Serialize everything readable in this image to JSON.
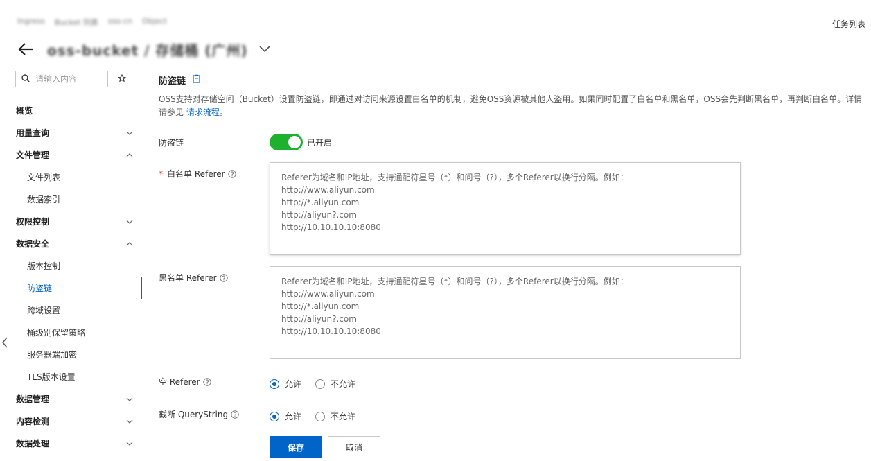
{
  "header": {
    "breadcrumb": [
      "Ingress",
      "Bucket 列表",
      "oss-cn",
      "Object"
    ],
    "task_list": "任务列表",
    "bucket_title": "oss-bucket / 存储桶 (广州)"
  },
  "sidebar": {
    "search_placeholder": "请输入内容",
    "items": [
      {
        "label": "概览",
        "type": "group",
        "chevron": "none"
      },
      {
        "label": "用量查询",
        "type": "group",
        "chevron": "down"
      },
      {
        "label": "文件管理",
        "type": "group",
        "chevron": "up"
      },
      {
        "label": "文件列表",
        "type": "sub",
        "chevron": "none"
      },
      {
        "label": "数据索引",
        "type": "sub",
        "chevron": "none"
      },
      {
        "label": "权限控制",
        "type": "group",
        "chevron": "down"
      },
      {
        "label": "数据安全",
        "type": "group",
        "chevron": "up"
      },
      {
        "label": "版本控制",
        "type": "sub",
        "chevron": "none"
      },
      {
        "label": "防盗链",
        "type": "sub",
        "chevron": "none",
        "active": true
      },
      {
        "label": "跨域设置",
        "type": "sub",
        "chevron": "none"
      },
      {
        "label": "桶级别保留策略",
        "type": "sub",
        "chevron": "none"
      },
      {
        "label": "服务器端加密",
        "type": "sub",
        "chevron": "none"
      },
      {
        "label": "TLS版本设置",
        "type": "sub",
        "chevron": "none"
      },
      {
        "label": "数据管理",
        "type": "group",
        "chevron": "down"
      },
      {
        "label": "内容检测",
        "type": "group",
        "chevron": "down"
      },
      {
        "label": "数据处理",
        "type": "group",
        "chevron": "down"
      }
    ]
  },
  "main": {
    "title": "防盗链",
    "desc_text": "OSS支持对存储空间（Bucket）设置防盗链，即通过对访问来源设置白名单的机制，避免OSS资源被其他人盗用。如果同时配置了白名单和黑名单，OSS会先判断黑名单，再判断白名单。详情请参见 ",
    "desc_link": "请求流程",
    "desc_end": "。",
    "hotlink_label": "防盗链",
    "switch_status": "已开启",
    "whitelist_required": "*",
    "whitelist_label": "白名单 Referer",
    "whitelist_placeholder": "Referer为域名和IP地址，支持通配符星号（*）和问号（?），多个Referer以换行分隔。例如：\nhttp://www.aliyun.com\nhttp://*.aliyun.com\nhttp://aliyun?.com\nhttp://10.10.10.10:8080",
    "blacklist_label": "黑名单 Referer",
    "blacklist_placeholder": "Referer为域名和IP地址，支持通配符星号（*）和问号（?），多个Referer以换行分隔。例如：\nhttp://www.aliyun.com\nhttp://*.aliyun.com\nhttp://aliyun?.com\nhttp://10.10.10.10:8080",
    "empty_referer_label": "空 Referer",
    "truncate_label": "截断 QueryString",
    "allow": "允许",
    "disallow": "不允许",
    "save": "保存",
    "cancel": "取消"
  },
  "colors": {
    "primary": "#0064c8",
    "switch_on": "#1eb12e",
    "required": "#d93026"
  }
}
